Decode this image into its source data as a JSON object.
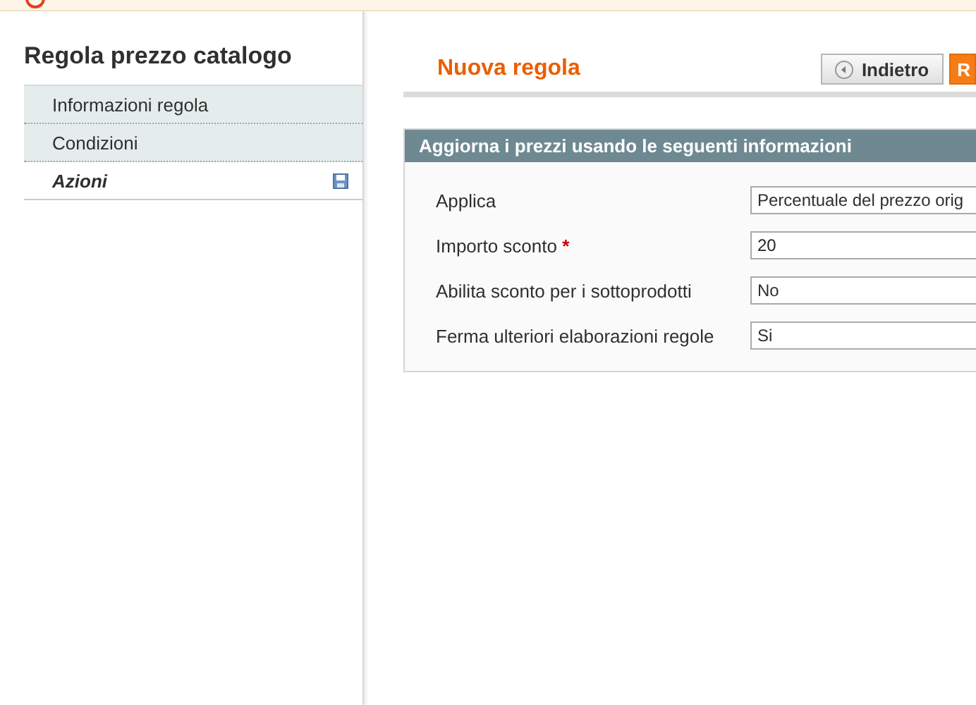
{
  "sidebar": {
    "title": "Regola prezzo catalogo",
    "tabs": [
      {
        "label": "Informazioni regola",
        "selected": false,
        "changed": false
      },
      {
        "label": "Condizioni",
        "selected": false,
        "changed": false
      },
      {
        "label": "Azioni",
        "selected": true,
        "changed": true
      }
    ]
  },
  "header": {
    "title": "Nuova regola",
    "buttons": [
      {
        "label": "Indietro",
        "kind": "back"
      },
      {
        "label": "R",
        "kind": "primary"
      }
    ]
  },
  "fieldset": {
    "legend": "Aggiorna i prezzi usando le seguenti informazioni",
    "fields": [
      {
        "label": "Applica",
        "kind": "select",
        "value": "Percentuale del prezzo orig"
      },
      {
        "label": "Importo sconto",
        "required_mark": "*",
        "kind": "text",
        "value": "20"
      },
      {
        "label": "Abilita sconto per i sottoprodotti",
        "kind": "select",
        "value": "No"
      },
      {
        "label": "Ferma ulteriori elaborazioni regole",
        "kind": "select",
        "value": "Si"
      }
    ]
  }
}
